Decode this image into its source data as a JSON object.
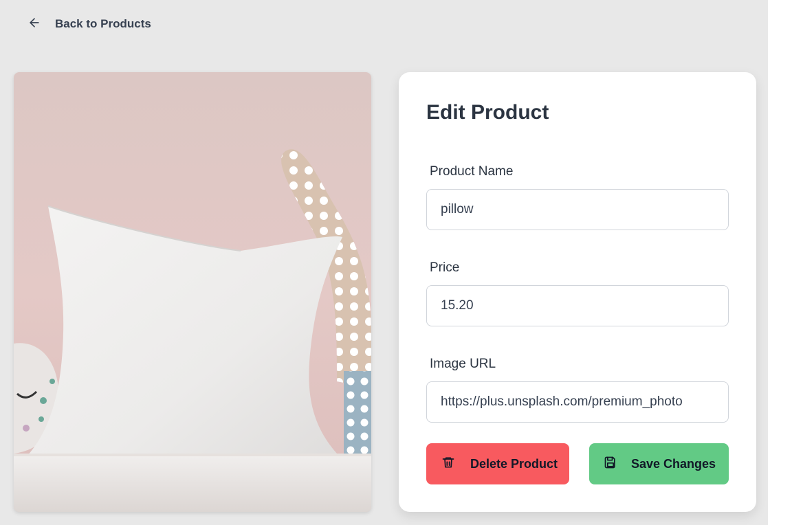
{
  "nav": {
    "back_label": "Back to Products",
    "back_icon": "arrow-left-icon"
  },
  "product_image": {
    "subject": "white pillow"
  },
  "form": {
    "title": "Edit Product",
    "name_label": "Product Name",
    "name_value": "pillow",
    "price_label": "Price",
    "price_value": "15.20",
    "image_label": "Image URL",
    "image_value": "https://plus.unsplash.com/premium_photo"
  },
  "actions": {
    "delete_label": "Delete Product",
    "delete_icon": "trash-icon",
    "delete_color": "#f85a5f",
    "save_label": "Save Changes",
    "save_icon": "save-icon",
    "save_color": "#62ca85"
  }
}
